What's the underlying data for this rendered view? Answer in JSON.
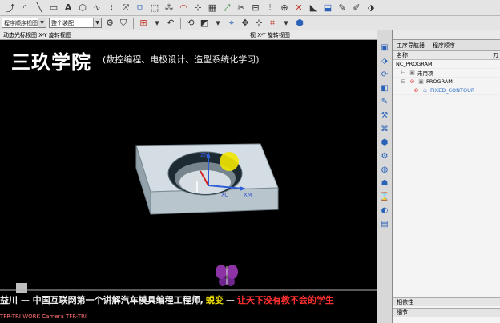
{
  "toolbar1": {
    "icons": [
      "pointer-icon",
      "arc-icon",
      "line-icon",
      "rectangle-icon",
      "text-icon",
      "shape-icon",
      "curve-icon",
      "spline-icon",
      "transform-icon",
      "mirror-icon",
      "shape-tool-icon",
      "pattern-icon",
      "fillet-icon",
      "measure-icon",
      "grid-icon"
    ]
  },
  "toolbar2": {
    "select1": "程序顺序视图",
    "select2": "整个装配"
  },
  "viewport_bar": {
    "left": "动态光标视图 X-Y 旋转视图",
    "right": "视 X-Y 旋转视图"
  },
  "viewport": {
    "academy_title": "三玖学院",
    "academy_subtitle": "(数控编程、电极设计、造型系统化学习)",
    "axis_zm": "ZM",
    "axis_xc": "XC",
    "axis_xm": "XM",
    "banner_a": "益川 — 中国互联网第一个讲解汽车模具编程工程师,",
    "banner_b": "蜕变",
    "banner_c": "—",
    "banner_d": "让天下没有教不会的学生",
    "status": "TFR-TRI WORK Camera TFR-TRI"
  },
  "panel": {
    "tab1": "工序导航器",
    "tab2": "程序顺序",
    "col_name": "名称",
    "col_right": "刀",
    "rows": [
      {
        "label": "NC_PROGRAM",
        "icon": "program-icon",
        "indent": 0
      },
      {
        "label": "未用项",
        "icon": "folder-icon",
        "indent": 1
      },
      {
        "label": "PROGRAM",
        "icon": "program-red-icon",
        "indent": 1
      },
      {
        "label": "FIXED_CONTOUR",
        "icon": "operation-icon",
        "indent": 3
      }
    ],
    "section1": "相依性",
    "section2": "细节"
  },
  "colors": {
    "banner_yellow": "#f4e000",
    "banner_red": "#ff3030",
    "selected_blue": "#2c6fc9"
  }
}
